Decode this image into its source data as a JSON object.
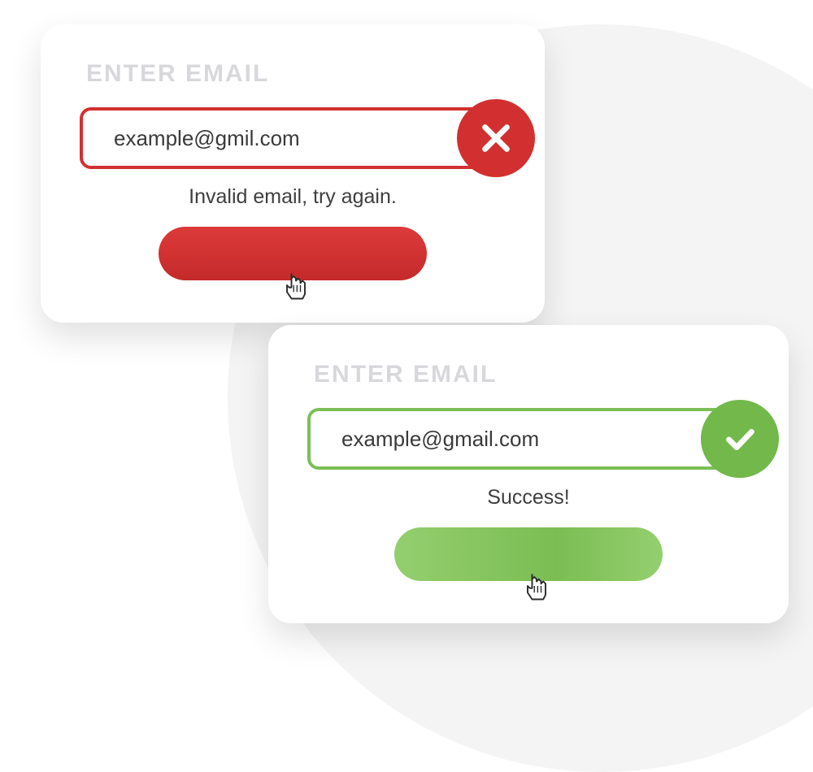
{
  "colors": {
    "error": "#d23030",
    "success": "#72b84b"
  },
  "error_card": {
    "label": "ENTER EMAIL",
    "input_value": "example@gmil.com",
    "status_text": "Invalid email, try again.",
    "badge_icon": "x-icon"
  },
  "success_card": {
    "label": "ENTER EMAIL",
    "input_value": "example@gmail.com",
    "status_text": "Success!",
    "badge_icon": "check-icon"
  }
}
